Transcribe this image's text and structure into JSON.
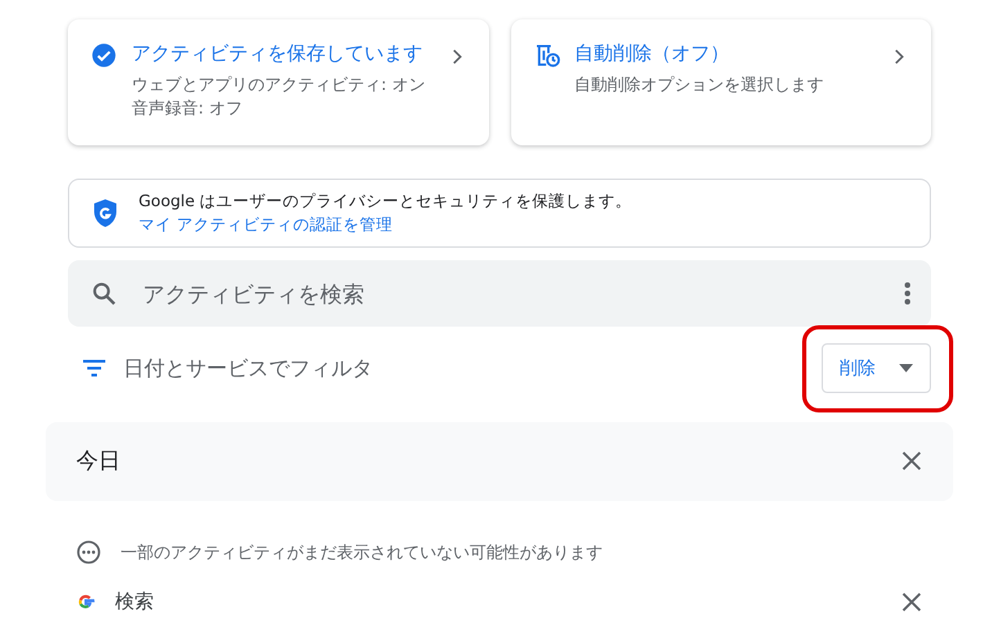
{
  "cards": [
    {
      "kind": "saving",
      "title": "アクティビティを保存しています",
      "lines": [
        "ウェブとアプリのアクティビティ: オン",
        "音声録音: オフ"
      ]
    },
    {
      "kind": "autodelete",
      "title": "自動削除（オフ）",
      "lines": [
        "自動削除オプションを選択します"
      ]
    }
  ],
  "privacy": {
    "text": "Google はユーザーのプライバシーとセキュリティを保護します。",
    "link": "マイ アクティビティの認証を管理"
  },
  "search": {
    "placeholder": "アクティビティを検索"
  },
  "filter": {
    "label": "日付とサービスでフィルタ"
  },
  "delete_button": {
    "label": "削除",
    "highlighted": true
  },
  "day": {
    "title": "今日"
  },
  "notice": "一部のアクティビティがまだ表示されていない可能性があります",
  "items": [
    {
      "label": "検索"
    }
  ]
}
